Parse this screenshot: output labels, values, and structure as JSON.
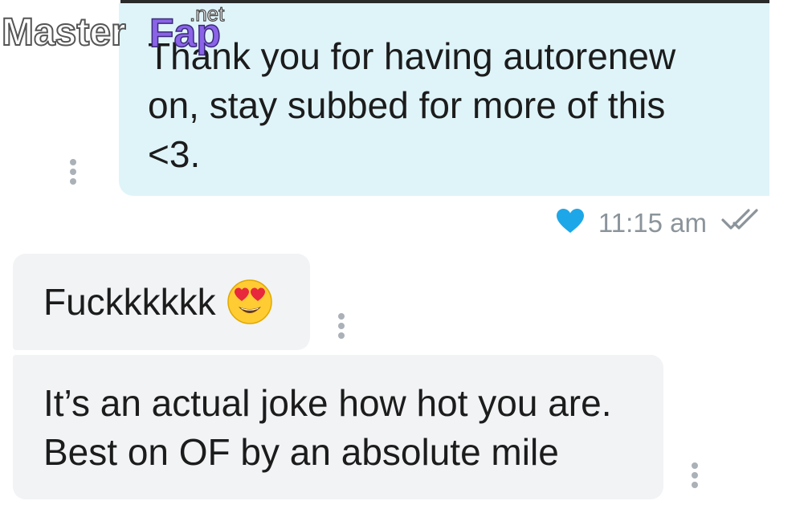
{
  "watermark": {
    "brand_left": "Master",
    "brand_right": "Fap",
    "suffix": ".net"
  },
  "messages": [
    {
      "side": "sent",
      "text": "Thank you for having autorenew\non, stay subbed for more of this\n<3."
    },
    {
      "side": "received",
      "text": "Fuckkkkkk",
      "emoji": "heart-eyes-emoji"
    },
    {
      "side": "received",
      "text": "It’s an actual joke how hot you are.\nBest on OF by an absolute mile"
    }
  ],
  "sent_meta": {
    "time": "11:15 am",
    "like_icon": "heart-icon",
    "read_icon": "double-check-icon"
  },
  "colors": {
    "sent_bubble": "#dff4f9",
    "received_bubble": "#f1f3f5",
    "heart": "#1ea7e8",
    "time_text": "#8b949b",
    "more_dots": "#aab1b7"
  }
}
